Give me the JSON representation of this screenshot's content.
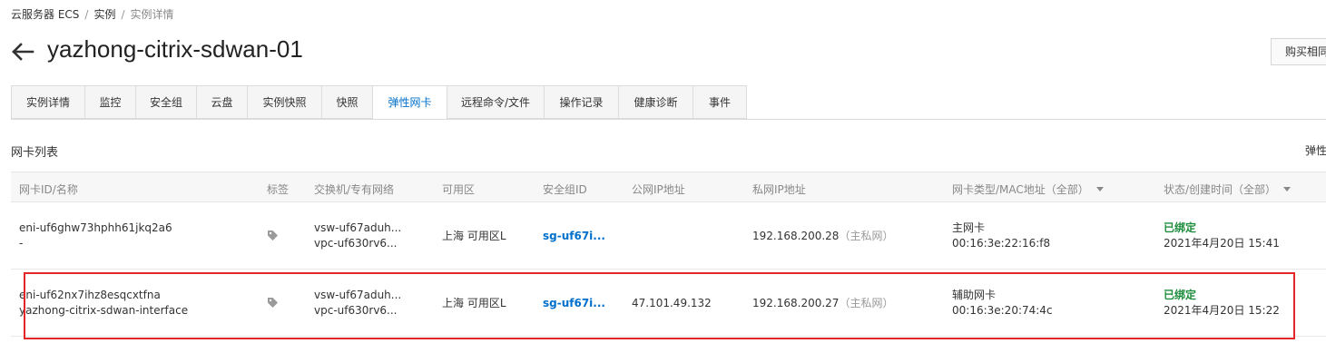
{
  "breadcrumb": {
    "items": [
      "云服务器 ECS",
      "实例",
      "实例详情"
    ]
  },
  "header": {
    "title": "yazhong-citrix-sdwan-01",
    "buy_button": "购买相同"
  },
  "tabs": [
    "实例详情",
    "监控",
    "安全组",
    "云盘",
    "实例快照",
    "快照",
    "弹性网卡",
    "远程命令/文件",
    "操作记录",
    "健康诊断",
    "事件"
  ],
  "active_tab": "弹性网卡",
  "section": {
    "title": "网卡列表",
    "right_text": "弹性"
  },
  "table": {
    "headers": {
      "id_name": "网卡ID/名称",
      "tags": "标签",
      "vswitch_vpc": "交换机/专有网络",
      "zone": "可用区",
      "sg": "安全组ID",
      "public_ip": "公网IP地址",
      "private_ip": "私网IP地址",
      "type_mac": "网卡类型/MAC地址（全部）",
      "status_time": "状态/创建时间（全部）"
    },
    "rows": [
      {
        "id": "eni-uf6ghw73hphh61jkq2a6",
        "name": "-",
        "vswitch": "vsw-uf67aduh...",
        "vpc": "vpc-uf630rv6...",
        "zone": "上海 可用区L",
        "sg": "sg-uf67i...",
        "public_ip": "",
        "private_ip": "192.168.200.28",
        "private_ip_note": "（主私网）",
        "type": "主网卡",
        "mac": "00:16:3e:22:16:f8",
        "status": "已绑定",
        "created": "2021年4月20日 15:41"
      },
      {
        "id": "eni-uf62nx7ihz8esqcxtfna",
        "name": "yazhong-citrix-sdwan-interface",
        "vswitch": "vsw-uf67aduh...",
        "vpc": "vpc-uf630rv6...",
        "zone": "上海 可用区L",
        "sg": "sg-uf67i...",
        "public_ip": "47.101.49.132",
        "private_ip": "192.168.200.27",
        "private_ip_note": "（主私网）",
        "type": "辅助网卡",
        "mac": "00:16:3e:20:74:4c",
        "status": "已绑定",
        "created": "2021年4月20日 15:22"
      }
    ]
  },
  "colors": {
    "accent": "#0070cc",
    "status_ok": "#1e8e3e",
    "highlight": "#e3262a"
  }
}
